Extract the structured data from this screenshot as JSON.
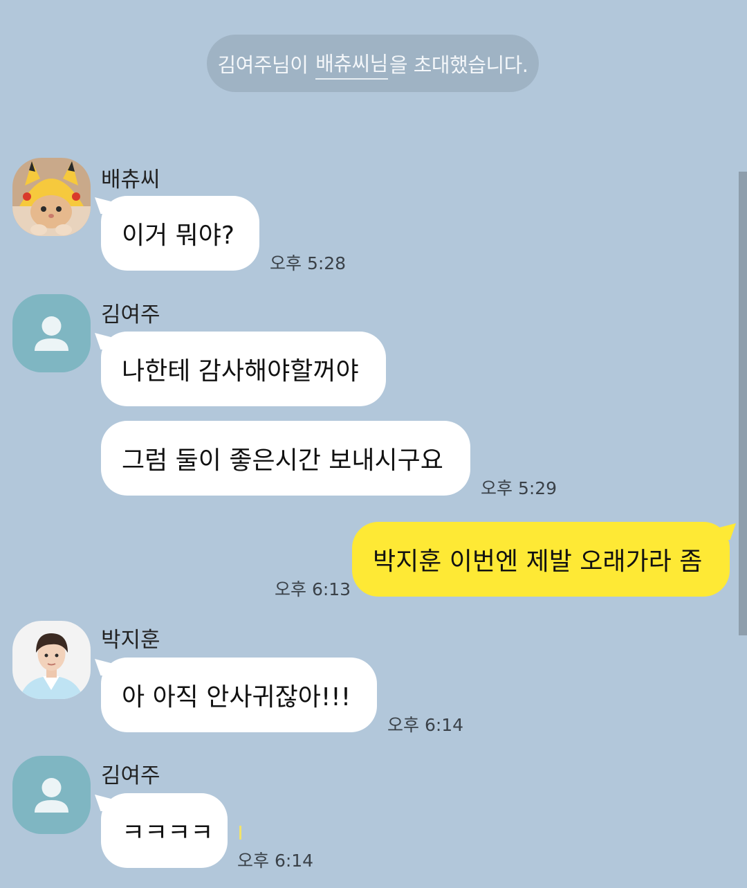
{
  "system_message": {
    "prefix": "김여주님이",
    "invitee": "배츄씨님",
    "suffix": "을 초대했습니다."
  },
  "messages": [
    {
      "sender": "배츄씨",
      "text": "이거 뭐야?",
      "time": "오후 5:28"
    },
    {
      "sender": "김여주",
      "text": "나한테 감사해야할꺼야"
    },
    {
      "text": "그럼 둘이 좋은시간 보내시구요",
      "time": "오후 5:29"
    },
    {
      "text": "박지훈 이번엔 제발 오래가라 좀",
      "time": "오후 6:13",
      "mine": true
    },
    {
      "sender": "박지훈",
      "text": "아 아직 안사귀잖아!!!",
      "time": "오후 6:14"
    },
    {
      "sender": "김여주",
      "text": "ㅋㅋㅋㅋ",
      "time": "오후 6:14"
    }
  ],
  "colors": {
    "background": "#b2c7da",
    "my_bubble": "#fee935",
    "other_bubble": "#ffffff",
    "default_avatar": "#7fb6c2"
  },
  "icons": {
    "default_avatar": "person-icon",
    "pikachu_avatar": "cat-pikachu-hat-photo",
    "parkjihoon_avatar": "profile-photo"
  }
}
